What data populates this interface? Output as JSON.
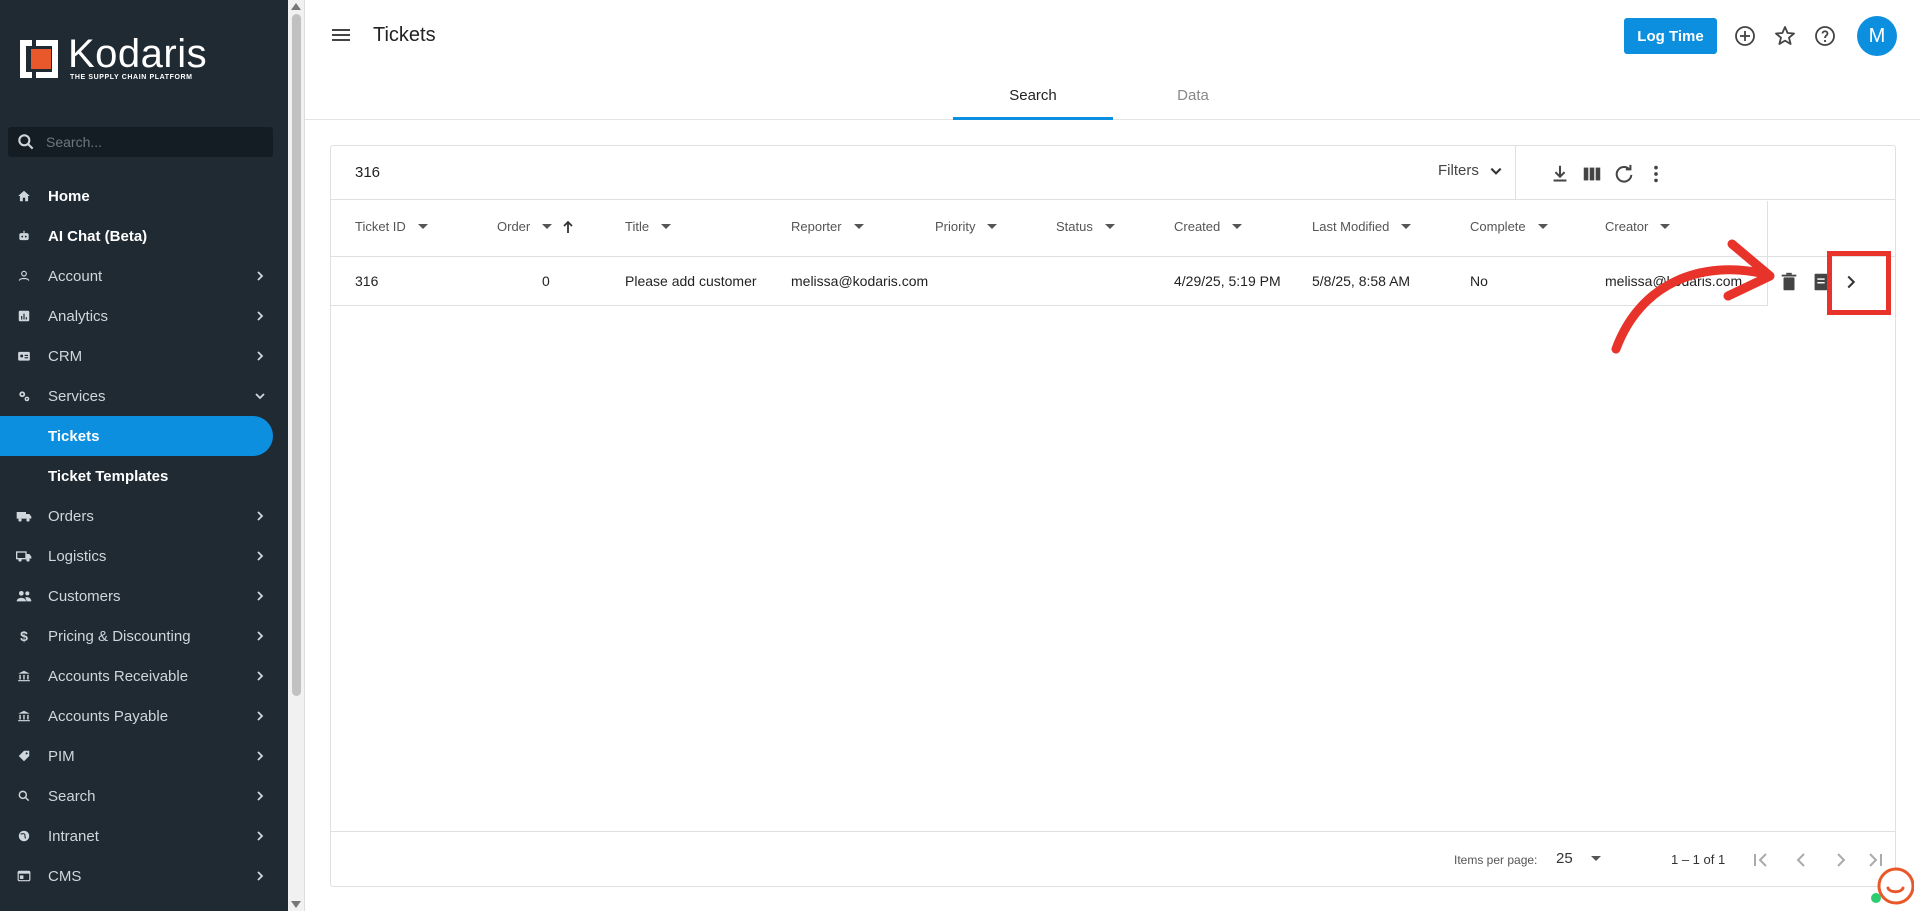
{
  "brand": {
    "name": "Kodaris",
    "tagline": "THE SUPPLY CHAIN PLATFORM"
  },
  "sidebar": {
    "search_placeholder": "Search...",
    "items": [
      {
        "label": "Home",
        "icon": "home-icon",
        "bold": true
      },
      {
        "label": "AI Chat (Beta)",
        "icon": "robot-icon",
        "bold": true
      },
      {
        "label": "Account",
        "icon": "person-icon"
      },
      {
        "label": "Analytics",
        "icon": "analytics-icon"
      },
      {
        "label": "CRM",
        "icon": "contact-card-icon"
      },
      {
        "label": "Services",
        "icon": "settings-gears-icon",
        "expanded": true
      },
      {
        "label": "Tickets",
        "sub": true,
        "active": true
      },
      {
        "label": "Ticket Templates",
        "sub": true
      },
      {
        "label": "Orders",
        "icon": "truck-icon"
      },
      {
        "label": "Logistics",
        "icon": "delivery-truck-icon"
      },
      {
        "label": "Customers",
        "icon": "people-icon"
      },
      {
        "label": "Pricing & Discounting",
        "icon": "dollar-icon"
      },
      {
        "label": "Accounts Receivable",
        "icon": "bank-icon"
      },
      {
        "label": "Accounts Payable",
        "icon": "bank-icon"
      },
      {
        "label": "PIM",
        "icon": "tag-icon"
      },
      {
        "label": "Search",
        "icon": "search-icon"
      },
      {
        "label": "Intranet",
        "icon": "globe-icon"
      },
      {
        "label": "CMS",
        "icon": "web-icon"
      }
    ]
  },
  "header": {
    "title": "Tickets",
    "log_time_label": "Log Time",
    "avatar_initial": "M"
  },
  "tabs": [
    {
      "label": "Search",
      "active": true
    },
    {
      "label": "Data",
      "active": false
    }
  ],
  "table": {
    "total_count": "316",
    "filters_label": "Filters",
    "columns": [
      "Ticket ID",
      "Order",
      "Title",
      "Reporter",
      "Priority",
      "Status",
      "Created",
      "Last Modified",
      "Complete",
      "Creator"
    ],
    "rows": [
      {
        "ticket_id": "316",
        "order": "0",
        "title": "Please add customer",
        "reporter": "melissa@kodaris.com",
        "priority": "",
        "status": "",
        "created": "4/29/25, 5:19 PM",
        "last_modified": "5/8/25, 8:58 AM",
        "complete": "No",
        "creator": "melissa@kodaris.com"
      }
    ]
  },
  "paginator": {
    "items_per_page_label": "Items per page:",
    "items_per_page": "25",
    "range_label": "1 – 1 of 1"
  },
  "colors": {
    "accent": "#0d8fe0",
    "sidebar_bg": "#202a33",
    "annotation": "#e8332b"
  }
}
